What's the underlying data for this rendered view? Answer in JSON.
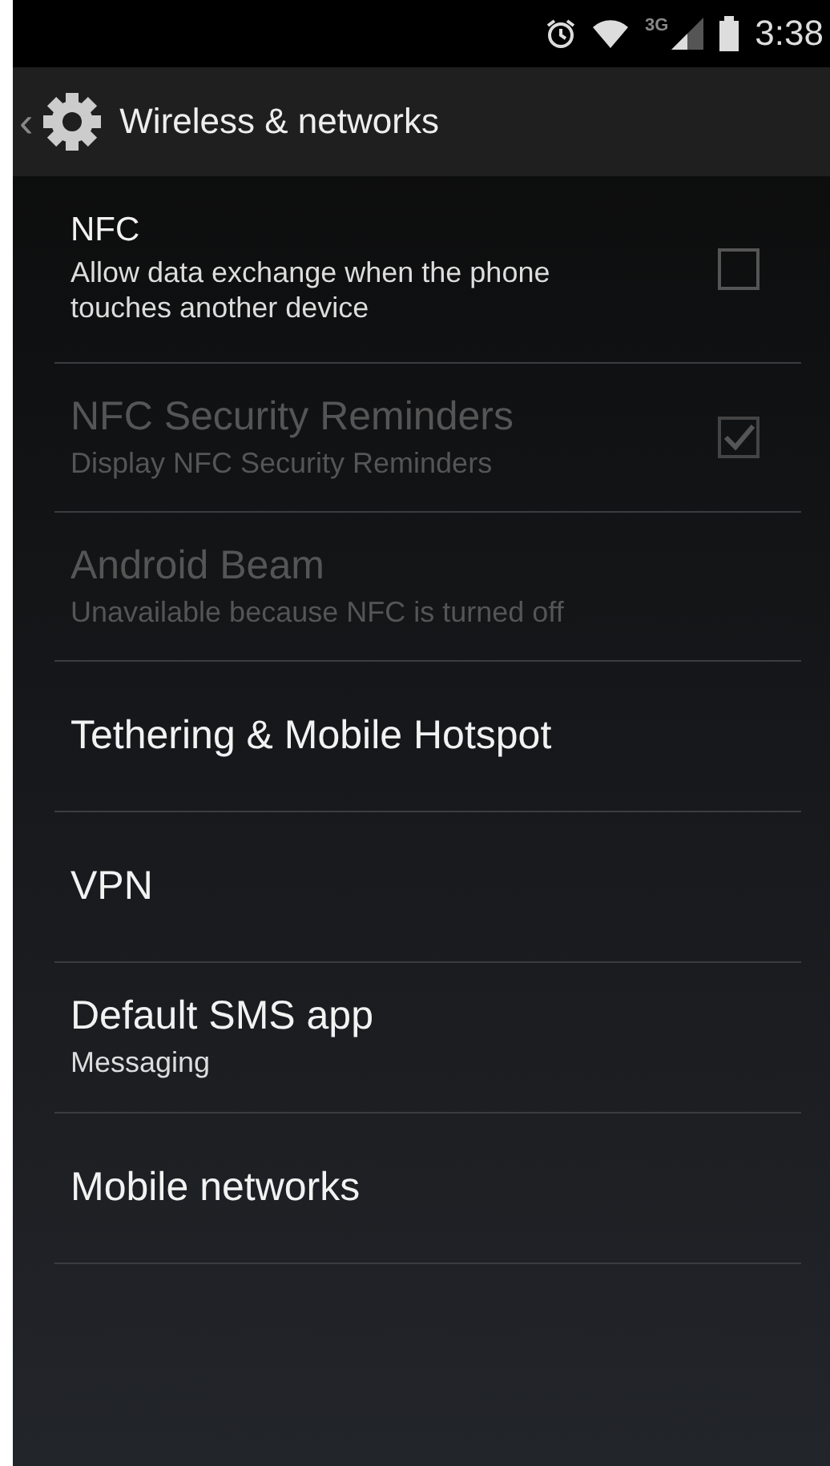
{
  "status_bar": {
    "time": "3:38",
    "network": "3G"
  },
  "action_bar": {
    "back": "‹",
    "title": "Wireless & networks"
  },
  "items": [
    {
      "kind": "checkbox",
      "title": "NFC",
      "summary": "Allow data exchange when the phone touches another device",
      "checked": false,
      "disabled": false
    },
    {
      "kind": "checkbox",
      "title": "NFC Security Reminders",
      "summary": "Display NFC Security Reminders",
      "checked": true,
      "disabled": true
    },
    {
      "kind": "plain",
      "title": "Android Beam",
      "summary": "Unavailable because NFC is turned off",
      "disabled": true
    },
    {
      "kind": "plain",
      "title": "Tethering & Mobile Hotspot",
      "disabled": false
    },
    {
      "kind": "plain",
      "title": "VPN",
      "disabled": false
    },
    {
      "kind": "plain",
      "title": "Default SMS app",
      "summary": "Messaging",
      "disabled": false
    },
    {
      "kind": "plain",
      "title": "Mobile networks",
      "disabled": false
    }
  ]
}
